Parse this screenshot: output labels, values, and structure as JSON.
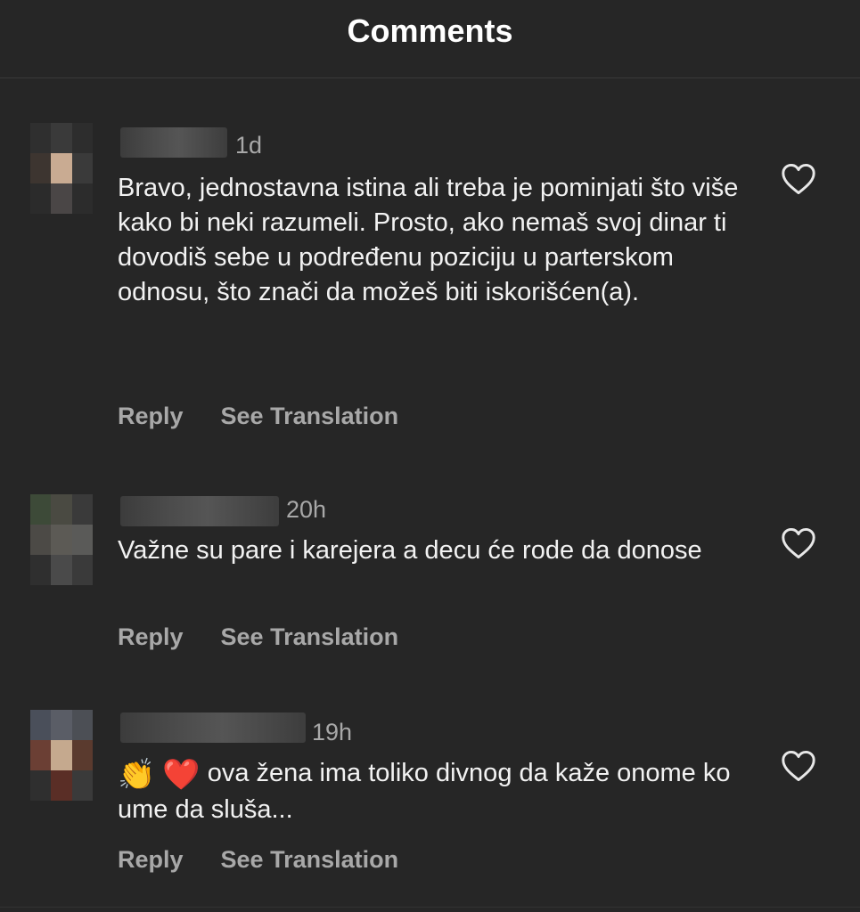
{
  "header": {
    "title": "Comments"
  },
  "comments": [
    {
      "time": "1d",
      "text": "Bravo, jednostavna istina ali treba je pominjati što više kako bi neki razumeli. Prosto, ako nemaš svoj dinar ti dovodiš sebe u podređenu poziciju u parterskom odnosu, što znači da možeš biti iskorišćen(a).",
      "reply_label": "Reply",
      "translate_label": "See Translation",
      "avatar_colors": [
        "#2f2f2f",
        "#3a3a3a",
        "#2d2d2d",
        "#3d3530",
        "#c9ab92",
        "#3a3a3a",
        "#2b2b2b",
        "#4a4646",
        "#2c2c2c"
      ]
    },
    {
      "time": "20h",
      "text": "Važne su pare i karejera a decu će rode da donose",
      "reply_label": "Reply",
      "translate_label": "See Translation",
      "avatar_colors": [
        "#3d4a38",
        "#4a4a42",
        "#3a3a3a",
        "#4c4a46",
        "#5c5a55",
        "#5a5a58",
        "#2f2f2f",
        "#4a4a4a",
        "#3a3a3a"
      ]
    },
    {
      "time": "19h",
      "emojis": [
        "👏",
        "❤️"
      ],
      "text": "ova žena ima toliko divnog da kaže onome ko ume da sluša...",
      "reply_label": "Reply",
      "translate_label": "See Translation",
      "avatar_colors": [
        "#4a4f5a",
        "#5a5d66",
        "#4c4f55",
        "#6b3f34",
        "#c5a98e",
        "#5a3a2e",
        "#2f2f2f",
        "#5a2e26",
        "#3a3a3a"
      ]
    }
  ],
  "colors": {
    "background": "#262626",
    "secondary_text": "#a8a8a8",
    "primary_text": "#f5f5f5"
  },
  "icons": {
    "like": "heart-outline-icon"
  }
}
